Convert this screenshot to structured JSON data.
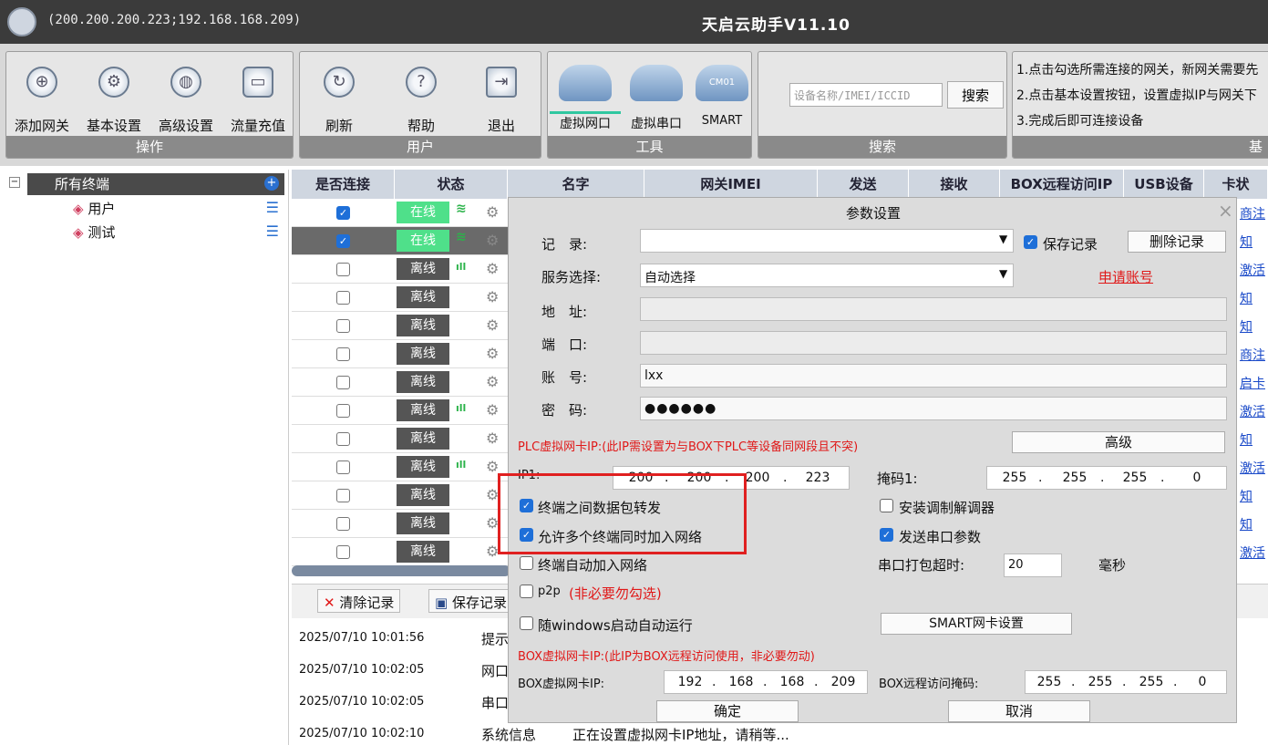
{
  "window": {
    "ips": "(200.200.200.223;192.168.168.209)",
    "title": "天启云助手V11.10"
  },
  "toolbar": {
    "groups": {
      "ops": "操作",
      "user": "用户",
      "tools": "工具",
      "search": "搜索",
      "basic": "基"
    },
    "ops": [
      "添加网关",
      "基本设置",
      "高级设置",
      "流量充值"
    ],
    "user": [
      "刷新",
      "帮助",
      "退出"
    ],
    "tools": [
      "虚拟网口",
      "虚拟串口",
      "SMART"
    ],
    "cloud_labels": [
      "CM01"
    ],
    "search_placeholder": "设备名称/IMEI/ICCID",
    "search_button": "搜索",
    "help": [
      "1.点击勾选所需连接的网关，新网关需要先",
      "2.点击基本设置按钮，设置虚拟IP与网关下",
      "3.完成后即可连接设备"
    ]
  },
  "tree": {
    "root": "所有终端",
    "items": [
      "用户",
      "测试"
    ]
  },
  "grid": {
    "headers": [
      "是否连接",
      "状态",
      "名字",
      "网关IMEI",
      "发送",
      "接收",
      "BOX远程访问IP",
      "USB设备",
      "卡状"
    ],
    "online": "在线",
    "offline": "离线",
    "rows": [
      {
        "checked": true,
        "on": true,
        "sig": "wifi",
        "link": "商注"
      },
      {
        "checked": true,
        "on": true,
        "sig": "wifi",
        "link": "知"
      },
      {
        "checked": false,
        "on": false,
        "sig": "4G",
        "link": "激活"
      },
      {
        "checked": false,
        "on": false,
        "sig": "",
        "link": "知"
      },
      {
        "checked": false,
        "on": false,
        "sig": "",
        "link": "知"
      },
      {
        "checked": false,
        "on": false,
        "sig": "",
        "link": "商注"
      },
      {
        "checked": false,
        "on": false,
        "sig": "",
        "link": "启卡"
      },
      {
        "checked": false,
        "on": false,
        "sig": "4G",
        "link": "激活"
      },
      {
        "checked": false,
        "on": false,
        "sig": "",
        "link": "知"
      },
      {
        "checked": false,
        "on": false,
        "sig": "4G",
        "link": "激活"
      },
      {
        "checked": false,
        "on": false,
        "sig": "",
        "link": "知"
      },
      {
        "checked": false,
        "on": false,
        "sig": "",
        "link": "知"
      },
      {
        "checked": false,
        "on": false,
        "sig": "",
        "link": "激活"
      }
    ]
  },
  "log": {
    "clear": "清除记录",
    "save": "保存记录",
    "rows": [
      {
        "time": "2025/07/10 10:01:56",
        "type": "提示",
        "msg": ""
      },
      {
        "time": "2025/07/10 10:02:05",
        "type": "网口",
        "msg": ""
      },
      {
        "time": "2025/07/10 10:02:05",
        "type": "串口",
        "msg": ""
      },
      {
        "time": "2025/07/10 10:02:10",
        "type": "系统信息",
        "msg": "正在设置虚拟网卡IP地址，请稍等..."
      }
    ]
  },
  "dialog": {
    "title": "参数设置",
    "record_label": "记　录:",
    "record_value": "",
    "save_record": "保存记录",
    "delete_record": "删除记录",
    "service_label": "服务选择:",
    "service_value": "自动选择",
    "apply_account": "申请账号",
    "address_label": "地　址:",
    "port_label": "端　口:",
    "account_label": "账　号:",
    "account_value": "lxx",
    "password_label": "密　码:",
    "password_value": "●●●●●●",
    "plc_note": "PLC虚拟网卡IP:(此IP需设置为与BOX下PLC等设备同网段且不突)",
    "advanced": "高级",
    "ip1_label": "IP1:",
    "ip1": [
      "200",
      "200",
      "200",
      "223"
    ],
    "mask1_label": "掩码1:",
    "mask1": [
      "255",
      "255",
      "255",
      "0"
    ],
    "opt_forward": "终端之间数据包转发",
    "opt_multi": "允许多个终端同时加入网络",
    "opt_autojoin": "终端自动加入网络",
    "opt_p2p": "p2p",
    "p2p_note": "(非必要勿勾选)",
    "opt_autostart": "随windows启动自动运行",
    "opt_modem": "安装调制解调器",
    "opt_serial": "发送串口参数",
    "serial_timeout_label": "串口打包超时:",
    "serial_timeout": "20",
    "ms": "毫秒",
    "smart_button": "SMART网卡设置",
    "box_note": "BOX虚拟网卡IP:(此IP为BOX远程访问使用，非必要勿动)",
    "box_ip_label": "BOX虚拟网卡IP:",
    "box_ip": [
      "192",
      "168",
      "168",
      "209"
    ],
    "box_mask_label": "BOX远程访问掩码:",
    "box_mask": [
      "255",
      "255",
      "255",
      "0"
    ],
    "ok": "确定",
    "cancel": "取消"
  }
}
